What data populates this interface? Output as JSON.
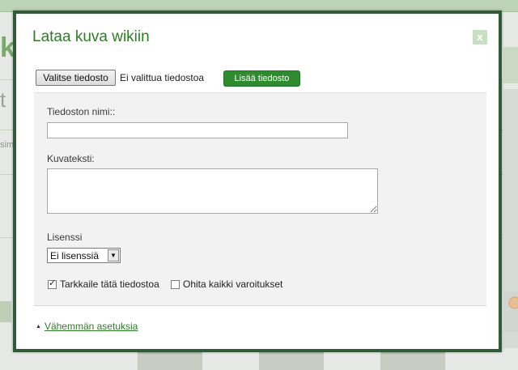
{
  "background": {
    "logo_fragment": "ki",
    "letter_fragment": "t",
    "small_text_fragment": "sim"
  },
  "dialog": {
    "title": "Lataa kuva wikiin",
    "close_label": "x",
    "choose_file_label": "Valitse tiedosto",
    "no_file_text": "Ei valittua tiedostoa",
    "add_file_label": "Lisää tiedosto",
    "filename_label": "Tiedoston nimi::",
    "filename_value": "",
    "caption_label": "Kuvateksti:",
    "caption_value": "",
    "license_label": "Lisenssi",
    "license_selected": "Ei lisenssiä",
    "watch_label": "Tarkkaile tätä tiedostoa",
    "watch_checked": true,
    "ignore_warnings_label": "Ohita kaikki varoitukset",
    "ignore_warnings_checked": false,
    "fewer_options_label": "Vähemmän asetuksia"
  },
  "colors": {
    "accent_green": "#2e7d26",
    "button_green": "#2e8b2e",
    "modal_border": "#2f5b38",
    "panel_bg": "#f2f2f2"
  },
  "icons": {
    "close": "close-icon",
    "collapse": "triangle-up-icon",
    "dropdown": "chevron-down-icon",
    "check": "checkmark-icon"
  }
}
